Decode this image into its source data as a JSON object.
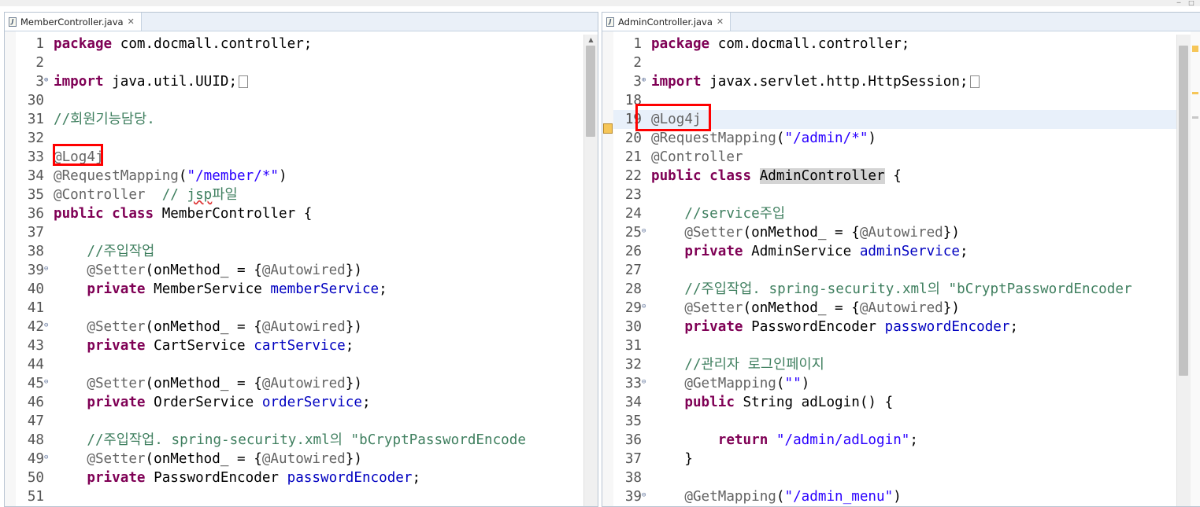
{
  "left_editor": {
    "tab_title": "MemberController.java",
    "tab_icon": "java-file-icon",
    "lines": [
      {
        "n": "1",
        "fold": "",
        "segs": [
          [
            "kw",
            "package"
          ],
          [
            "",
            " com.docmall.controller;"
          ]
        ]
      },
      {
        "n": "2",
        "fold": "",
        "segs": []
      },
      {
        "n": "3",
        "fold": "⊕",
        "segs": [
          [
            "kw",
            "import"
          ],
          [
            "",
            " java.util.UUID;"
          ],
          [
            "collapsed",
            ""
          ]
        ]
      },
      {
        "n": "30",
        "fold": "",
        "segs": []
      },
      {
        "n": "31",
        "fold": "",
        "segs": [
          [
            "cmt",
            "//회원기능담당."
          ]
        ]
      },
      {
        "n": "32",
        "fold": "",
        "segs": []
      },
      {
        "n": "33",
        "fold": "",
        "segs": [
          [
            "ann",
            "@Log4j"
          ]
        ]
      },
      {
        "n": "34",
        "fold": "",
        "segs": [
          [
            "ann",
            "@RequestMapping"
          ],
          [
            "",
            "("
          ],
          [
            "str",
            "\"/member/*\""
          ],
          [
            "",
            ")"
          ]
        ]
      },
      {
        "n": "35",
        "fold": "",
        "segs": [
          [
            "ann",
            "@Controller"
          ],
          [
            "",
            "  "
          ],
          [
            "cmt",
            "// "
          ],
          [
            "cmt squig",
            "jsp"
          ],
          [
            "cmt",
            "파일"
          ]
        ]
      },
      {
        "n": "36",
        "fold": "",
        "segs": [
          [
            "kw",
            "public"
          ],
          [
            "",
            " "
          ],
          [
            "kw",
            "class"
          ],
          [
            "",
            " MemberController {"
          ]
        ]
      },
      {
        "n": "37",
        "fold": "",
        "segs": []
      },
      {
        "n": "38",
        "fold": "",
        "segs": [
          [
            "",
            "    "
          ],
          [
            "cmt",
            "//주입작업"
          ]
        ]
      },
      {
        "n": "39",
        "fold": "⊖",
        "segs": [
          [
            "",
            "    "
          ],
          [
            "ann",
            "@Setter"
          ],
          [
            "",
            "(onMethod_ = {"
          ],
          [
            "ann",
            "@Autowired"
          ],
          [
            "",
            "})"
          ]
        ]
      },
      {
        "n": "40",
        "fold": "",
        "segs": [
          [
            "",
            "    "
          ],
          [
            "kw",
            "private"
          ],
          [
            "",
            " MemberService "
          ],
          [
            "fld",
            "memberService"
          ],
          [
            "",
            ";"
          ]
        ]
      },
      {
        "n": "41",
        "fold": "",
        "segs": []
      },
      {
        "n": "42",
        "fold": "⊖",
        "segs": [
          [
            "",
            "    "
          ],
          [
            "ann",
            "@Setter"
          ],
          [
            "",
            "(onMethod_ = {"
          ],
          [
            "ann",
            "@Autowired"
          ],
          [
            "",
            "})"
          ]
        ]
      },
      {
        "n": "43",
        "fold": "",
        "segs": [
          [
            "",
            "    "
          ],
          [
            "kw",
            "private"
          ],
          [
            "",
            " CartService "
          ],
          [
            "fld",
            "cartService"
          ],
          [
            "",
            ";"
          ]
        ]
      },
      {
        "n": "44",
        "fold": "",
        "segs": []
      },
      {
        "n": "45",
        "fold": "⊖",
        "segs": [
          [
            "",
            "    "
          ],
          [
            "ann",
            "@Setter"
          ],
          [
            "",
            "(onMethod_ = {"
          ],
          [
            "ann",
            "@Autowired"
          ],
          [
            "",
            "})"
          ]
        ]
      },
      {
        "n": "46",
        "fold": "",
        "segs": [
          [
            "",
            "    "
          ],
          [
            "kw",
            "private"
          ],
          [
            "",
            " OrderService "
          ],
          [
            "fld",
            "orderService"
          ],
          [
            "",
            ";"
          ]
        ]
      },
      {
        "n": "47",
        "fold": "",
        "segs": []
      },
      {
        "n": "48",
        "fold": "",
        "segs": [
          [
            "",
            "    "
          ],
          [
            "cmt",
            "//주입작업. spring-security.xml의 \"bCryptPasswordEncode"
          ]
        ]
      },
      {
        "n": "49",
        "fold": "⊖",
        "segs": [
          [
            "",
            "    "
          ],
          [
            "ann",
            "@Setter"
          ],
          [
            "",
            "(onMethod_ = {"
          ],
          [
            "ann",
            "@Autowired"
          ],
          [
            "",
            "})"
          ]
        ]
      },
      {
        "n": "50",
        "fold": "",
        "segs": [
          [
            "",
            "    "
          ],
          [
            "kw",
            "private"
          ],
          [
            "",
            " PasswordEncoder "
          ],
          [
            "fld",
            "passwordEncoder"
          ],
          [
            "",
            ";"
          ]
        ]
      },
      {
        "n": "51",
        "fold": "",
        "segs": []
      }
    ]
  },
  "right_editor": {
    "tab_title": "AdminController.java",
    "tab_icon": "java-file-icon",
    "lines": [
      {
        "n": "1",
        "fold": "",
        "segs": [
          [
            "kw",
            "package"
          ],
          [
            "",
            " com.docmall.controller;"
          ]
        ]
      },
      {
        "n": "2",
        "fold": "",
        "segs": []
      },
      {
        "n": "3",
        "fold": "⊕",
        "segs": [
          [
            "kw",
            "import"
          ],
          [
            "",
            " javax.servlet.http.HttpSession;"
          ],
          [
            "collapsed",
            ""
          ]
        ]
      },
      {
        "n": "18",
        "fold": "",
        "segs": []
      },
      {
        "n": "19",
        "fold": "",
        "cur": true,
        "segs": [
          [
            "ann",
            "@Log4j"
          ]
        ]
      },
      {
        "n": "20",
        "fold": "",
        "segs": [
          [
            "ann",
            "@RequestMapping"
          ],
          [
            "",
            "("
          ],
          [
            "str",
            "\"/admin/*\""
          ],
          [
            "",
            ")"
          ]
        ]
      },
      {
        "n": "21",
        "fold": "",
        "segs": [
          [
            "ann",
            "@Controller"
          ]
        ]
      },
      {
        "n": "22",
        "fold": "",
        "segs": [
          [
            "kw",
            "public"
          ],
          [
            "",
            " "
          ],
          [
            "kw",
            "class"
          ],
          [
            "",
            " "
          ],
          [
            "hl",
            "AdminController"
          ],
          [
            "",
            " {"
          ]
        ]
      },
      {
        "n": "23",
        "fold": "",
        "segs": []
      },
      {
        "n": "24",
        "fold": "",
        "segs": [
          [
            "",
            "    "
          ],
          [
            "cmt",
            "//service주입"
          ]
        ]
      },
      {
        "n": "25",
        "fold": "⊖",
        "segs": [
          [
            "",
            "    "
          ],
          [
            "ann",
            "@Setter"
          ],
          [
            "",
            "(onMethod_ = {"
          ],
          [
            "ann",
            "@Autowired"
          ],
          [
            "",
            "})"
          ]
        ]
      },
      {
        "n": "26",
        "fold": "",
        "segs": [
          [
            "",
            "    "
          ],
          [
            "kw",
            "private"
          ],
          [
            "",
            " AdminService "
          ],
          [
            "fld",
            "adminService"
          ],
          [
            "",
            ";"
          ]
        ]
      },
      {
        "n": "27",
        "fold": "",
        "segs": []
      },
      {
        "n": "28",
        "fold": "",
        "segs": [
          [
            "",
            "    "
          ],
          [
            "cmt",
            "//주입작업. spring-security.xml의 \"bCryptPasswordEncoder"
          ]
        ]
      },
      {
        "n": "29",
        "fold": "⊖",
        "segs": [
          [
            "",
            "    "
          ],
          [
            "ann",
            "@Setter"
          ],
          [
            "",
            "(onMethod_ = {"
          ],
          [
            "ann",
            "@Autowired"
          ],
          [
            "",
            "})"
          ]
        ]
      },
      {
        "n": "30",
        "fold": "",
        "segs": [
          [
            "",
            "    "
          ],
          [
            "kw",
            "private"
          ],
          [
            "",
            " PasswordEncoder "
          ],
          [
            "fld",
            "passwordEncoder"
          ],
          [
            "",
            ";"
          ]
        ]
      },
      {
        "n": "31",
        "fold": "",
        "segs": []
      },
      {
        "n": "32",
        "fold": "",
        "segs": [
          [
            "",
            "    "
          ],
          [
            "cmt",
            "//관리자 로그인페이지"
          ]
        ]
      },
      {
        "n": "33",
        "fold": "⊖",
        "segs": [
          [
            "",
            "    "
          ],
          [
            "ann",
            "@GetMapping"
          ],
          [
            "",
            "("
          ],
          [
            "str",
            "\"\""
          ],
          [
            "",
            ")"
          ]
        ]
      },
      {
        "n": "34",
        "fold": "",
        "segs": [
          [
            "",
            "    "
          ],
          [
            "kw",
            "public"
          ],
          [
            "",
            " String adLogin() {"
          ]
        ]
      },
      {
        "n": "35",
        "fold": "",
        "segs": []
      },
      {
        "n": "36",
        "fold": "",
        "segs": [
          [
            "",
            "        "
          ],
          [
            "kw",
            "return"
          ],
          [
            "",
            " "
          ],
          [
            "str",
            "\"/admin/adLogin\""
          ],
          [
            "",
            ";"
          ]
        ]
      },
      {
        "n": "37",
        "fold": "",
        "segs": [
          [
            "",
            "    }"
          ]
        ]
      },
      {
        "n": "38",
        "fold": "",
        "segs": []
      },
      {
        "n": "39",
        "fold": "⊖",
        "segs": [
          [
            "",
            "    "
          ],
          [
            "ann",
            "@GetMapping"
          ],
          [
            "",
            "("
          ],
          [
            "str",
            "\"/admin_menu\""
          ],
          [
            "",
            ")"
          ]
        ]
      }
    ]
  }
}
